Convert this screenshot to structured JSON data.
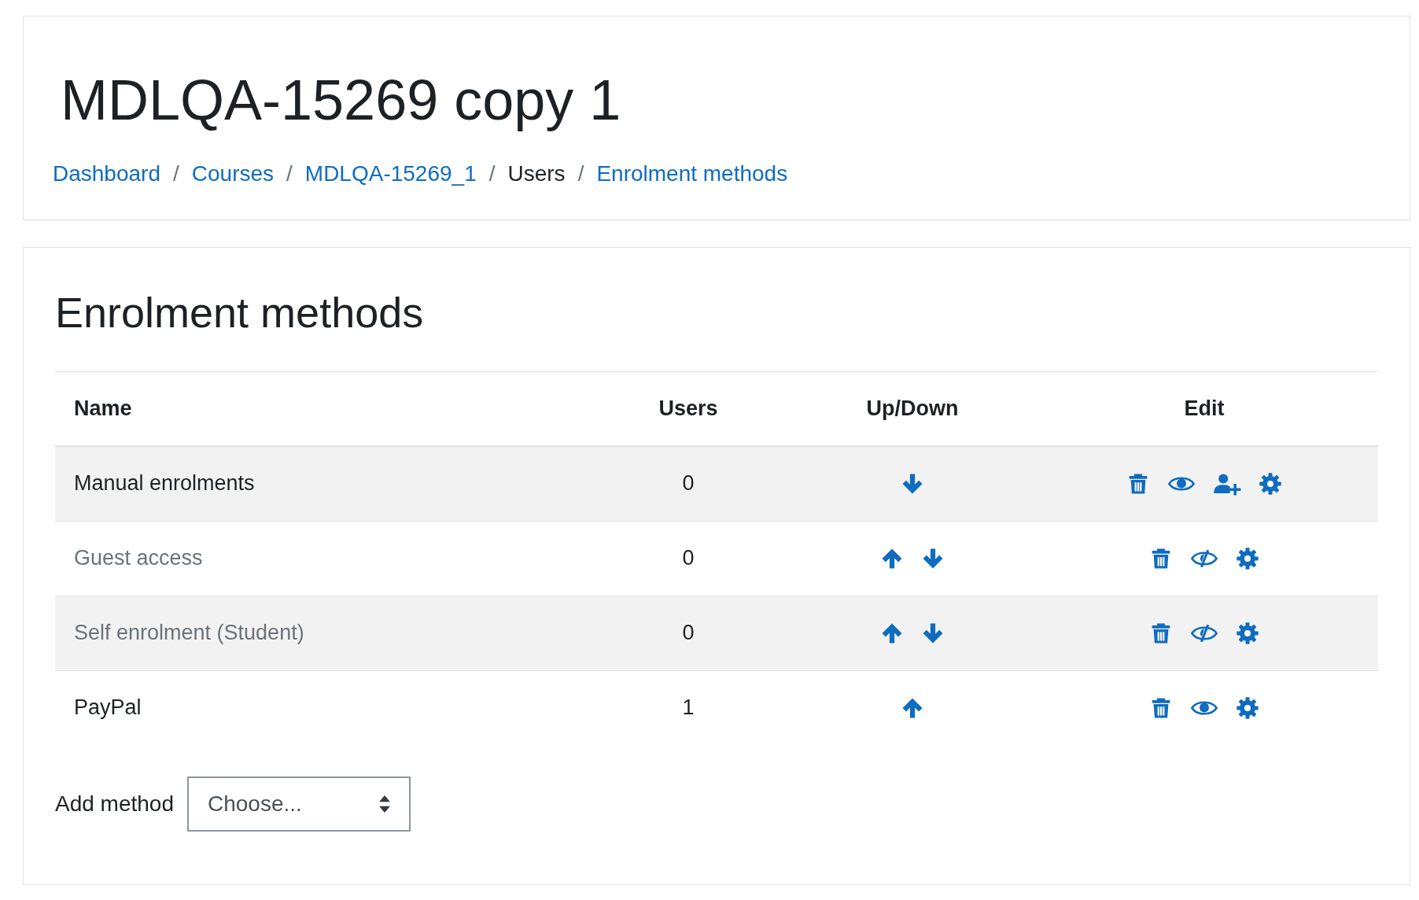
{
  "page_title": "MDLQA-15269 copy 1",
  "breadcrumb": [
    {
      "label": "Dashboard",
      "link": true
    },
    {
      "label": "Courses",
      "link": true
    },
    {
      "label": "MDLQA-15269_1",
      "link": true
    },
    {
      "label": "Users",
      "link": false
    },
    {
      "label": "Enrolment methods",
      "link": true
    }
  ],
  "breadcrumb_separator": "/",
  "section_title": "Enrolment methods",
  "table": {
    "columns": [
      "Name",
      "Users",
      "Up/Down",
      "Edit"
    ],
    "rows": [
      {
        "name": "Manual enrolments",
        "users": "0",
        "disabled": false,
        "up": false,
        "down": true,
        "actions": [
          {
            "kind": "delete"
          },
          {
            "kind": "visibility"
          },
          {
            "kind": "enrol"
          },
          {
            "kind": "settings"
          }
        ]
      },
      {
        "name": "Guest access",
        "users": "0",
        "disabled": true,
        "up": true,
        "down": true,
        "actions": [
          {
            "kind": "delete"
          },
          {
            "kind": "visibility"
          },
          {
            "kind": "settings"
          }
        ]
      },
      {
        "name": "Self enrolment (Student)",
        "users": "0",
        "disabled": true,
        "up": true,
        "down": true,
        "actions": [
          {
            "kind": "delete"
          },
          {
            "kind": "visibility"
          },
          {
            "kind": "settings"
          }
        ]
      },
      {
        "name": "PayPal",
        "users": "1",
        "disabled": false,
        "up": true,
        "down": false,
        "actions": [
          {
            "kind": "delete"
          },
          {
            "kind": "visibility"
          },
          {
            "kind": "settings"
          }
        ]
      }
    ]
  },
  "add_method": {
    "label": "Add method",
    "placeholder": "Choose..."
  }
}
